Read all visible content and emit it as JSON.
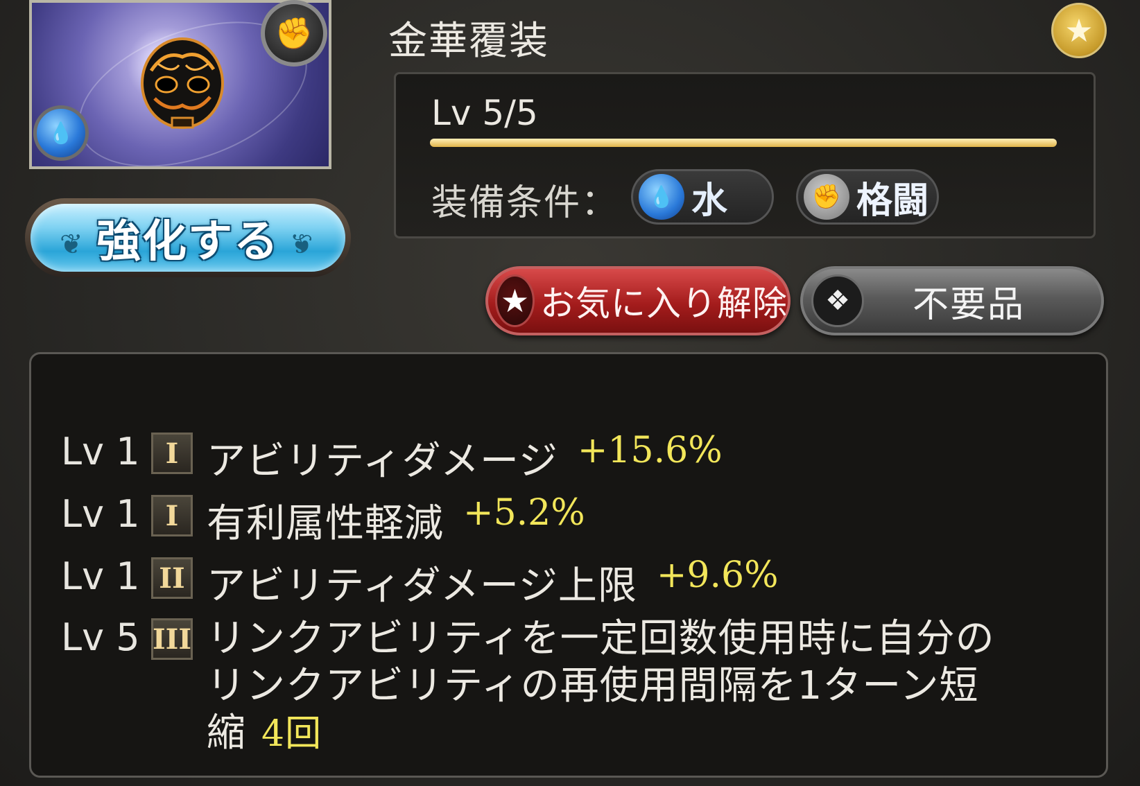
{
  "item": {
    "name": "金華覆装",
    "element_icon": "water-drops-icon",
    "type_icon": "fist-icon",
    "favorite_icon": "star-icon"
  },
  "level": {
    "text": "Lv 5/5",
    "current": 5,
    "max": 5
  },
  "equip_conditions": {
    "label": "装備条件：",
    "element": {
      "label": "水",
      "icon": "water-drops-icon",
      "color": "#2a79d9"
    },
    "weapon": {
      "label": "格闘",
      "icon": "fist-icon"
    }
  },
  "buttons": {
    "enhance": "強化する",
    "unfavorite": "お気に入り解除",
    "junk": "不要品"
  },
  "skills": [
    {
      "lv": "Lv 1",
      "tier": "I",
      "name": "アビリティダメージ",
      "value": "+15.6%"
    },
    {
      "lv": "Lv 1",
      "tier": "I",
      "name": "有利属性軽減",
      "value": "+5.2%"
    },
    {
      "lv": "Lv 1",
      "tier": "II",
      "name": "アビリティダメージ上限",
      "value": "+9.6%"
    },
    {
      "lv": "Lv 5",
      "tier": "III",
      "name": "リンクアビリティを一定回数使用時に自分のリンクアビリティの再使用間隔を1ターン短縮",
      "value": "4回"
    }
  ],
  "colors": {
    "value_yellow": "#f2e65a",
    "unfavorite_red": "#a41c1c",
    "enhance_blue": "#2aa5d8"
  }
}
